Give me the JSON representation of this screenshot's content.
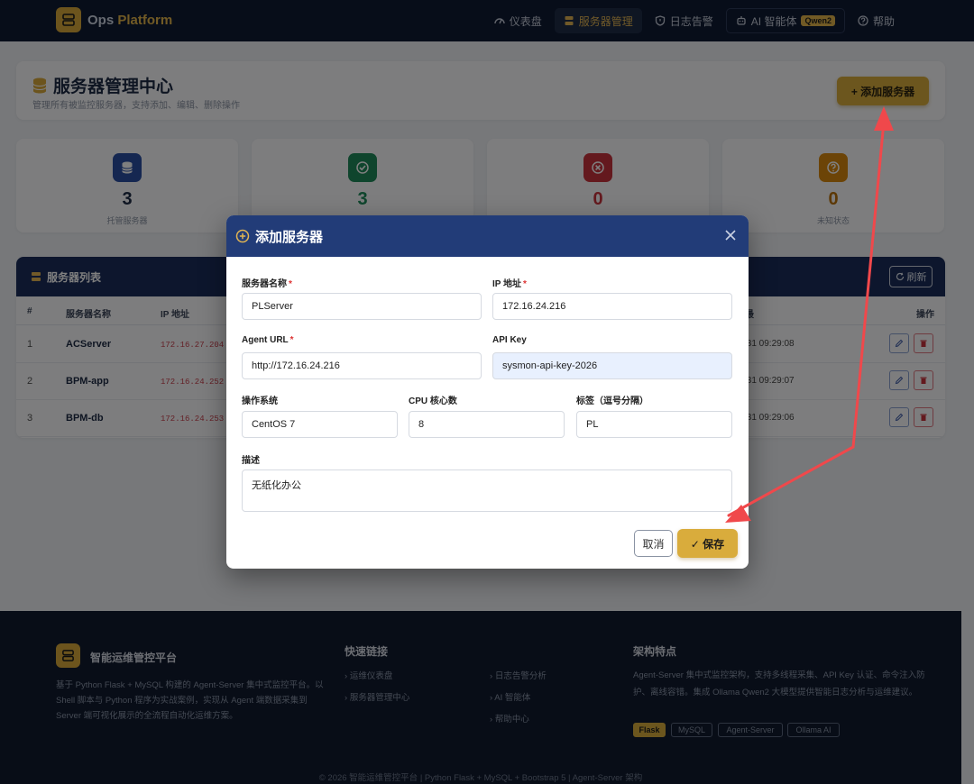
{
  "navbar": {
    "brand_ops": "Ops",
    "brand_platform": "Platform",
    "items": [
      {
        "label": "仪表盘",
        "icon": "dashboard-icon"
      },
      {
        "label": "服务器管理",
        "icon": "server-icon"
      },
      {
        "label": "日志告警",
        "icon": "shield-icon"
      },
      {
        "label": "AI 智能体",
        "icon": "robot-icon"
      },
      {
        "label": "帮助",
        "icon": "help-icon"
      }
    ],
    "ai_badge": "Qwen2",
    "accent": "#e2b54b"
  },
  "page_header": {
    "title": "服务器管理中心",
    "subtitle": "管理所有被监控服务器，支持添加、编辑、删除操作",
    "add_button": "+ 添加服务器"
  },
  "stats": [
    {
      "value": "3",
      "label": "托管服务器",
      "color": "#2b4fa3"
    },
    {
      "value": "3",
      "label": "",
      "color": "#1f8a5a"
    },
    {
      "value": "0",
      "label": "",
      "color": "#c8323c"
    },
    {
      "value": "0",
      "label": "未知状态",
      "color": "#d9890f"
    }
  ],
  "server_table": {
    "title": "服务器列表",
    "refresh": "刷新",
    "columns": {
      "num": "#",
      "name": "服务器名称",
      "ip": "IP 地址",
      "time": "最",
      "actions": "操作"
    },
    "rows": [
      {
        "num": "1",
        "name": "ACServer",
        "ip": "172.16.27.204",
        "time": "/31 09:29:08"
      },
      {
        "num": "2",
        "name": "BPM-app",
        "ip": "172.16.24.252",
        "time": "/31 09:29:07"
      },
      {
        "num": "3",
        "name": "BPM-db",
        "ip": "172.16.24.253",
        "time": "/31 09:29:06"
      }
    ]
  },
  "modal": {
    "title": "添加服务器",
    "fields": {
      "name_label": "服务器名称",
      "name_value": "PLServer",
      "ip_label": "IP 地址",
      "ip_value": "172.16.24.216",
      "url_label": "Agent URL",
      "url_value": "http://172.16.24.216",
      "key_label": "API Key",
      "key_value": "sysmon-api-key-2026",
      "os_label": "操作系统",
      "os_value": "CentOS 7",
      "cpu_label": "CPU 核心数",
      "cpu_value": "8",
      "tags_label": "标签（逗号分隔）",
      "tags_value": "PL",
      "desc_label": "描述",
      "desc_value": "无纸化办公"
    },
    "required_mark": "*",
    "cancel": "取消",
    "save": "✓ 保存"
  },
  "footer": {
    "title": "智能运维管控平台",
    "description": "基于 Python Flask + MySQL 构建的 Agent-Server 集中式监控平台。以 Shell 脚本与 Python 程序为实战案例，实现从 Agent 端数据采集到 Server 端可视化展示的全流程自动化运维方案。",
    "quick_links_title": "快速链接",
    "links_col1": [
      "运维仪表盘",
      "服务器管理中心"
    ],
    "links_col2": [
      "日志告警分析",
      "AI 智能体",
      "帮助中心"
    ],
    "arch_title": "架构特点",
    "arch_desc": "Agent-Server 集中式监控架构，支持多线程采集、API Key 认证、命令注入防护、离线容错。集成 Ollama Qwen2 大模型提供智能日志分析与运维建议。",
    "tags": [
      "Flask",
      "MySQL",
      "Agent-Server",
      "Ollama AI"
    ],
    "copyright": "© 2026 智能运维管控平台 | Python Flask + MySQL + Bootstrap 5 | Agent-Server 架构"
  }
}
